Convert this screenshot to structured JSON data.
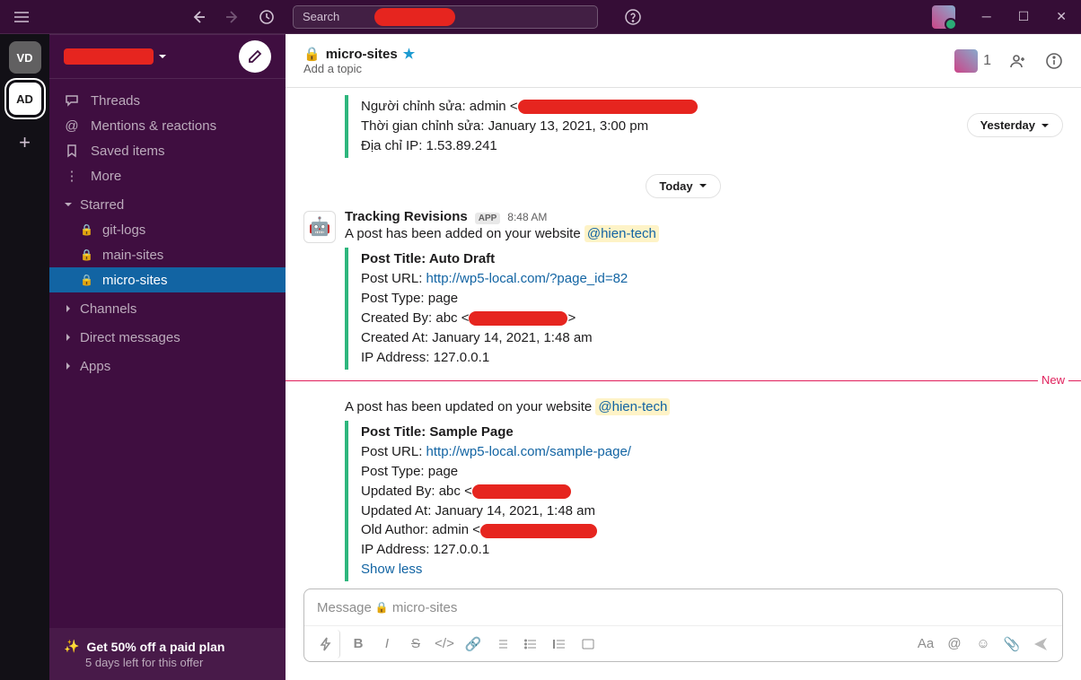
{
  "titlebar": {
    "search_placeholder": "Search"
  },
  "rail": {
    "workspaces": [
      {
        "initials": "VD"
      },
      {
        "initials": "AD"
      }
    ]
  },
  "sidebar": {
    "nav": {
      "threads": "Threads",
      "mentions": "Mentions & reactions",
      "saved": "Saved items",
      "more": "More"
    },
    "sections": {
      "starred": "Starred",
      "channels": "Channels",
      "dms": "Direct messages",
      "apps": "Apps"
    },
    "starred_channels": [
      {
        "name": "git-logs"
      },
      {
        "name": "main-sites"
      },
      {
        "name": "micro-sites"
      }
    ],
    "offer": {
      "title": "Get 50% off a paid plan",
      "subtitle": "5 days left for this offer"
    }
  },
  "channel": {
    "name": "micro-sites",
    "topic": "Add a topic",
    "members_count": "1"
  },
  "dividers": {
    "yesterday": "Yesterday",
    "today": "Today",
    "new": "New"
  },
  "messages": {
    "prev_attachment": {
      "line1_pre": "Người chỉnh sửa: admin <",
      "line2": "Thời gian chỉnh sửa: January 13, 2021, 3:00 pm",
      "line3": "Địa chỉ IP: 1.53.89.241"
    },
    "m1": {
      "author": "Tracking Revisions",
      "badge": "APP",
      "time": "8:48 AM",
      "text_pre": "A post has been added on your website  ",
      "mention": "@hien-tech",
      "att": {
        "title": "Post Title: Auto Draft",
        "url_label": "Post URL: ",
        "url": "http://wp5-local.com/?page_id=82",
        "type": "Post Type: page",
        "created_by_pre": "Created By: abc <",
        "created_at": "Created At: January 14, 2021, 1:48 am",
        "ip": "IP Address: 127.0.0.1"
      }
    },
    "m2": {
      "text_pre": "A post has been updated on your website  ",
      "mention": "@hien-tech",
      "att": {
        "title": "Post Title: Sample Page",
        "url_label": "Post URL: ",
        "url": "http://wp5-local.com/sample-page/",
        "type": "Post Type: page",
        "updated_by_pre": "Updated By: abc <",
        "updated_at": "Updated At: January 14, 2021, 1:48 am",
        "old_author_pre": "Old Author: admin <",
        "ip": "IP Address: 127.0.0.1",
        "show_less": "Show less"
      }
    }
  },
  "composer": {
    "placeholder_pre": "Message ",
    "placeholder_chan": "micro-sites"
  }
}
